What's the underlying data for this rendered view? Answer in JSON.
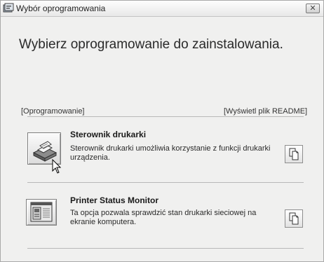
{
  "window": {
    "title": "Wybór oprogramowania",
    "close_glyph": "✕"
  },
  "heading": "Wybierz oprogramowanie do zainstalowania.",
  "section": {
    "left_label": "[Oprogramowanie]",
    "right_label": "[Wyświetl plik README]"
  },
  "items": [
    {
      "title": "Sterownik drukarki",
      "description": "Sterownik drukarki umożliwia korzystanie z funkcji drukarki urządzenia.",
      "icon": "printer-icon",
      "readme_icon": "document-icon"
    },
    {
      "title": "Printer Status Monitor",
      "description": "Ta opcja pozwala sprawdzić stan drukarki sieciowej na ekranie komputera.",
      "icon": "status-monitor-icon",
      "readme_icon": "document-icon"
    }
  ],
  "colors": {
    "window_bg": "#f0f0ef",
    "rule": "#b8b8b8",
    "text": "#2a2a2a"
  }
}
